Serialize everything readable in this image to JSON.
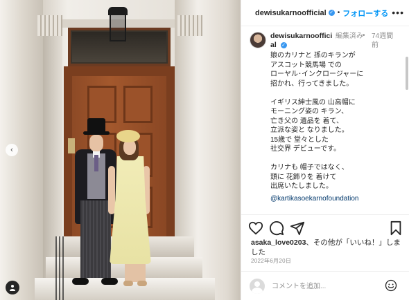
{
  "header": {
    "username": "dewisukarnoofficial",
    "separator": "•",
    "follow_label": "フォローする",
    "more_label": "•••"
  },
  "caption": {
    "username": "dewisukarnoofficial",
    "edited": "編集済み",
    "bullet": "•",
    "age": "74週間前",
    "text": "娘のカリナと 孫のキランが\nアスコット競馬場 での\nローヤル･インクロージャーに\n招かれ、行ってきました。\n\nイギリス紳士風の 山高帽に\nモーニング姿の キラン、\n亡き父の 遺品を 着て、\n立派な姿と なりました。\n15歳で 堂々とした\n社交界 デビューです。\n\nカリナも 帽子ではなく、\n頭に 花飾りを 着けて\n出席いたしました。",
    "link": "@kartikasoekarnofoundation"
  },
  "likes": {
    "user": "asaka_love0203",
    "text": "、その他が「いいね！」しました"
  },
  "date": "2022年6月20日",
  "comment": {
    "placeholder": "コメントを追加..."
  },
  "photo": {
    "prev_label": "‹"
  },
  "icons": {
    "like": "heart-icon",
    "comment": "comment-icon",
    "share": "share-icon",
    "save": "bookmark-icon",
    "emoji": "emoji-icon",
    "tag": "user-tag-icon"
  },
  "colors": {
    "accent": "#0095f6",
    "verified": "#3897f0",
    "text": "#262626",
    "muted": "#8e8e8e",
    "link": "#00376b"
  }
}
